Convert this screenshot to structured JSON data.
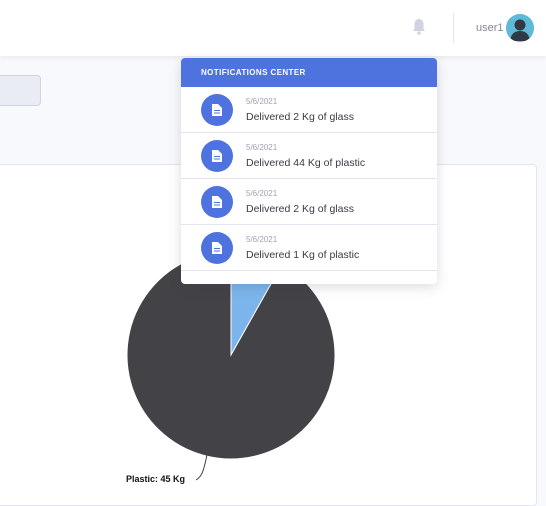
{
  "topbar": {
    "username": "user1",
    "bell_icon": "bell-icon",
    "avatar_icon": "user-avatar"
  },
  "notifications": {
    "header": "NOTIFICATIONS CENTER",
    "items": [
      {
        "date": "5/6/2021",
        "text": "Delivered 2 Kg of glass",
        "icon": "file-icon"
      },
      {
        "date": "5/6/2021",
        "text": "Delivered 44 Kg of plastic",
        "icon": "file-icon"
      },
      {
        "date": "5/6/2021",
        "text": "Delivered 2 Kg of glass",
        "icon": "file-icon"
      },
      {
        "date": "5/6/2021",
        "text": "Delivered 1 Kg of plastic",
        "icon": "file-icon"
      }
    ]
  },
  "colors": {
    "primary": "#4e73df",
    "pie_dark": "#434247",
    "pie_light": "#7cb5ec"
  },
  "chart_data": {
    "type": "pie",
    "slices": [
      {
        "label": "Plastic: 45 Kg",
        "value": 45,
        "color": "#434247"
      },
      {
        "value": 4,
        "color": "#7cb5ec"
      }
    ]
  }
}
